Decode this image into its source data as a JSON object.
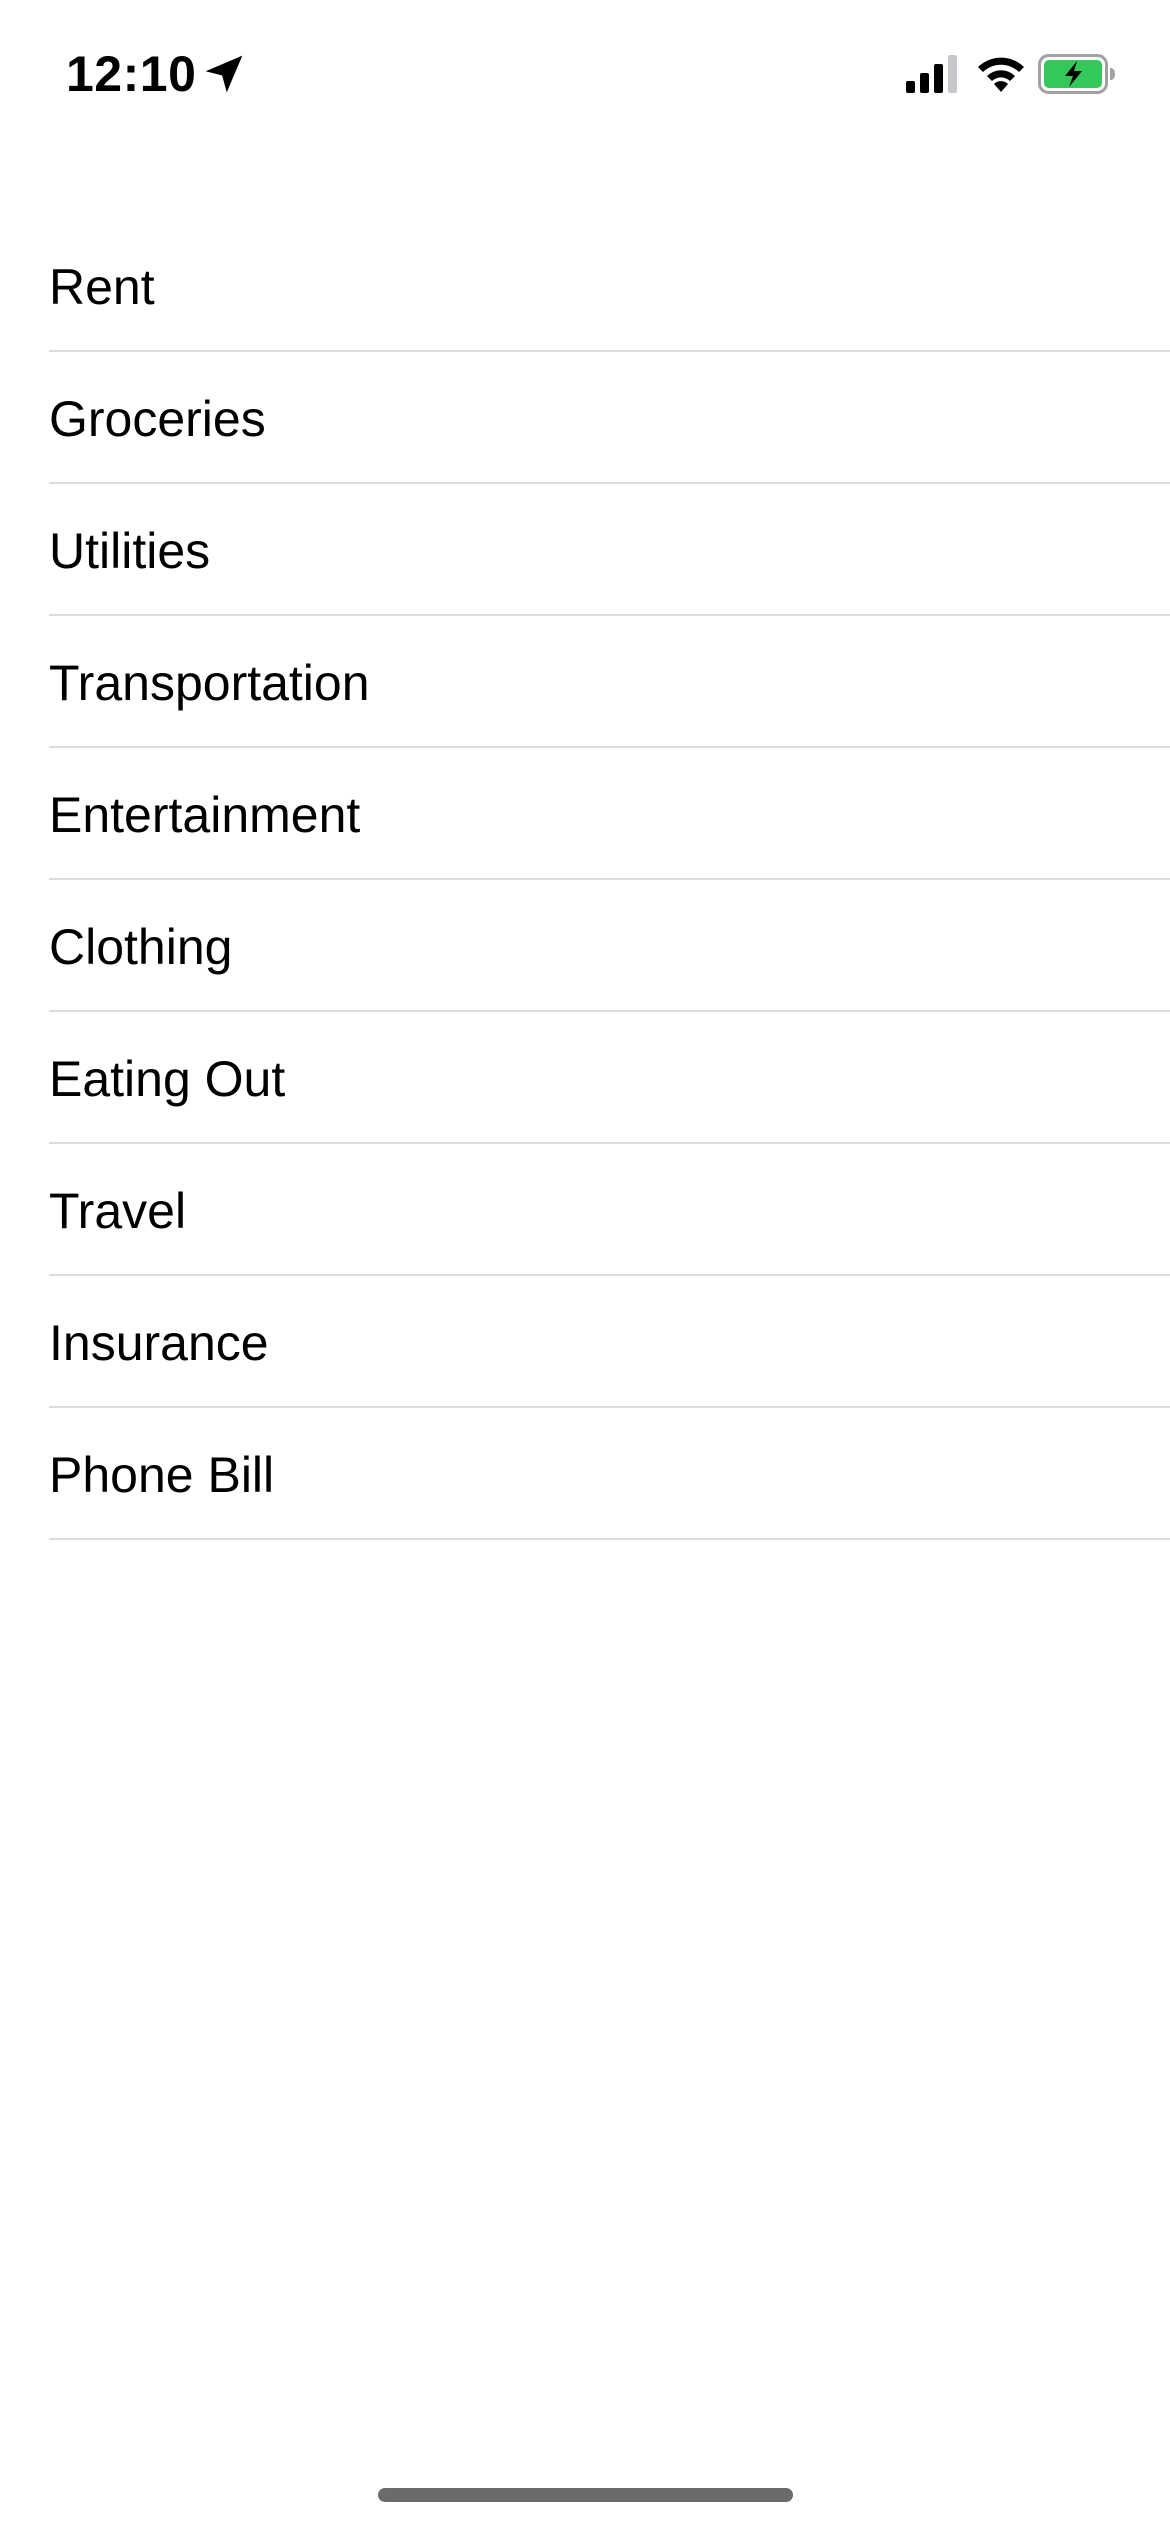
{
  "status_bar": {
    "time": "12:10",
    "icons": [
      "location-arrow-icon",
      "cellular-signal-icon",
      "wifi-icon",
      "battery-charging-icon"
    ],
    "battery_color": "#34C759"
  },
  "categories": [
    {
      "label": "Rent"
    },
    {
      "label": "Groceries"
    },
    {
      "label": "Utilities"
    },
    {
      "label": "Transportation"
    },
    {
      "label": "Entertainment"
    },
    {
      "label": "Clothing"
    },
    {
      "label": "Eating Out"
    },
    {
      "label": "Travel"
    },
    {
      "label": "Insurance"
    },
    {
      "label": "Phone Bill"
    }
  ],
  "colors": {
    "separator": "#DCDCDF",
    "text": "#000000",
    "background": "#FFFFFF",
    "home_indicator": "#6B6B6B"
  }
}
